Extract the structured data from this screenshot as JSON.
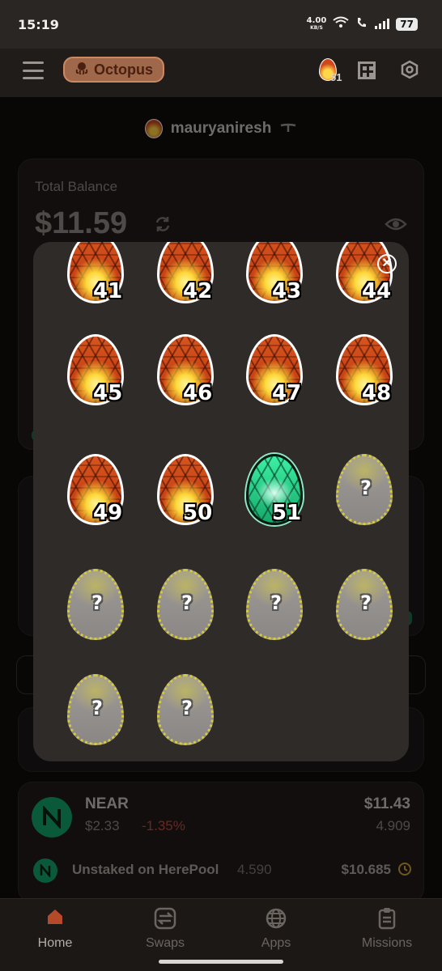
{
  "status": {
    "time": "15:19",
    "net_speed": "4.00",
    "net_unit": "KB/S",
    "battery": "77"
  },
  "appbar": {
    "brand_label": "Octopus",
    "egg_count": "51"
  },
  "account": {
    "username": "mauryaniresh"
  },
  "balance": {
    "label": "Total Balance",
    "value": "$11.59"
  },
  "assets": [
    {
      "name": "NEAR",
      "price": "$2.33",
      "change": "-1.35%",
      "value": "$11.43",
      "amount": "4.909"
    }
  ],
  "staking": {
    "label": "Unstaked on HerePool",
    "amount": "4.590",
    "value": "$10.685"
  },
  "nav": [
    {
      "label": "Home",
      "icon": "home-icon",
      "active": true
    },
    {
      "label": "Swaps",
      "icon": "swap-icon",
      "active": false
    },
    {
      "label": "Apps",
      "icon": "globe-icon",
      "active": false
    },
    {
      "label": "Missions",
      "icon": "clipboard-icon",
      "active": false
    }
  ],
  "egg_modal": {
    "eggs": [
      {
        "number": "41",
        "type": "fire"
      },
      {
        "number": "42",
        "type": "fire"
      },
      {
        "number": "43",
        "type": "fire"
      },
      {
        "number": "44",
        "type": "fire"
      },
      {
        "number": "45",
        "type": "fire"
      },
      {
        "number": "46",
        "type": "fire"
      },
      {
        "number": "47",
        "type": "fire"
      },
      {
        "number": "48",
        "type": "fire"
      },
      {
        "number": "49",
        "type": "fire"
      },
      {
        "number": "50",
        "type": "fire"
      },
      {
        "number": "51",
        "type": "emerald"
      },
      {
        "number": "?",
        "type": "locked"
      },
      {
        "number": "?",
        "type": "locked"
      },
      {
        "number": "?",
        "type": "locked"
      },
      {
        "number": "?",
        "type": "locked"
      },
      {
        "number": "?",
        "type": "locked"
      },
      {
        "number": "?",
        "type": "locked"
      },
      {
        "number": "?",
        "type": "locked"
      }
    ]
  },
  "colors": {
    "background": "#0f0d0c",
    "modal": "#2f2b29",
    "fire_egg": "#d5541e",
    "emerald_egg": "#3bf0a3",
    "locked_egg": "#9e9a98",
    "near_green": "#12a36b",
    "negative": "#c2463c",
    "active_nav": "#b44a2a"
  }
}
